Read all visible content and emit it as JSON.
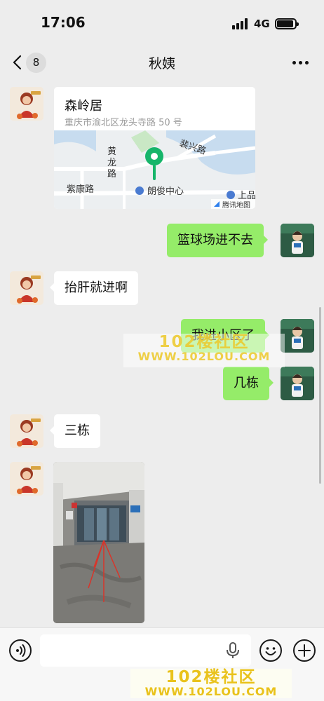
{
  "status_bar": {
    "time": "17:06",
    "network": "4G"
  },
  "nav": {
    "unread_count": "8",
    "title": "秋姨"
  },
  "location_message": {
    "name": "森岭居",
    "address": "重庆市渝北区龙头寺路 50 号",
    "map_labels": {
      "road_1": "裴兴路",
      "road_2_line1": "黄",
      "road_2_line2": "龙",
      "road_2_line3": "路",
      "road_3": "紫康路",
      "poi": "朗俊中心",
      "poi_partial": "上品",
      "map_brand": "腾讯地图"
    }
  },
  "messages": [
    {
      "sender": "me",
      "text": "篮球场进不去"
    },
    {
      "sender": "other",
      "text": "抬肝就进啊"
    },
    {
      "sender": "me",
      "text": "我进小区了"
    },
    {
      "sender": "me",
      "text": "几栋"
    },
    {
      "sender": "other",
      "text": "三栋"
    }
  ],
  "input": {
    "placeholder": ""
  },
  "watermark": {
    "main": "102楼社区",
    "url": "WWW.102LOU.COM"
  }
}
